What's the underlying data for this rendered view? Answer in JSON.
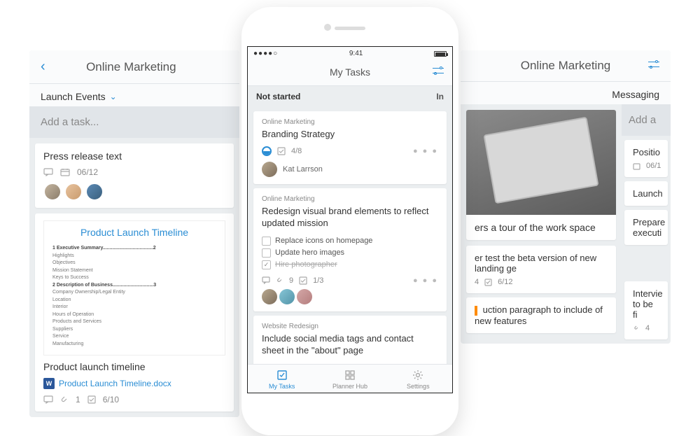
{
  "left": {
    "title": "Online Marketing",
    "bucket": "Launch Events",
    "addtask": "Add a task...",
    "card1": {
      "title": "Press release text",
      "date": "06/12"
    },
    "doc": {
      "thumb_title": "Product Launch Timeline",
      "toc": [
        "1    Executive Summary.....................................2",
        "       Highlights",
        "       Objectives",
        "       Mission Statement",
        "       Keys to Success",
        "2    Description of Business..............................3",
        "       Company Ownership/Legal Entity",
        "       Location",
        "       Interior",
        "       Hours of Operation",
        "       Products and Services",
        "       Suppliers",
        "       Service",
        "       Manufacturing"
      ],
      "card_title": "Product launch timeline",
      "filename": "Product Launch Timeline.docx",
      "attachments": "1",
      "checklist": "6/10"
    }
  },
  "right": {
    "title": "Online Marketing",
    "bucket": "Messaging",
    "addtask": "Add a",
    "card1": {
      "title": "Positio",
      "date": "06/1"
    },
    "card2": {
      "title": "Launch"
    },
    "photo_caption": "ers a tour of the work space",
    "card3": {
      "title": "er test the beta version of new landing ge",
      "date": "4",
      "checklist": "6/12"
    },
    "card4": {
      "title": "Prepare executi"
    },
    "card5": {
      "title": "uction paragraph to include of new features"
    },
    "card6": {
      "title": "Intervie to be fi",
      "attachments": "4"
    }
  },
  "phone": {
    "status_time": "9:41",
    "header": "My Tasks",
    "bucket": "Not started",
    "bucket_right": "In",
    "task1": {
      "plan": "Online Marketing",
      "title": "Branding Strategy",
      "checklist": "4/8",
      "assignee": "Kat Larrson"
    },
    "task2": {
      "plan": "Online Marketing",
      "title": "Redesign visual brand elements to reflect updated mission",
      "items": [
        {
          "label": "Replace icons on homepage",
          "done": false
        },
        {
          "label": "Update hero images",
          "done": false
        },
        {
          "label": "Hire photographer",
          "done": true
        }
      ],
      "attachments": "9",
      "checklist": "1/3"
    },
    "task3": {
      "plan": "Website Redesign",
      "title": "Include social media tags and contact sheet in the \"about\" page"
    },
    "nav": {
      "mytasks": "My Tasks",
      "hub": "Planner Hub",
      "settings": "Settings"
    }
  }
}
